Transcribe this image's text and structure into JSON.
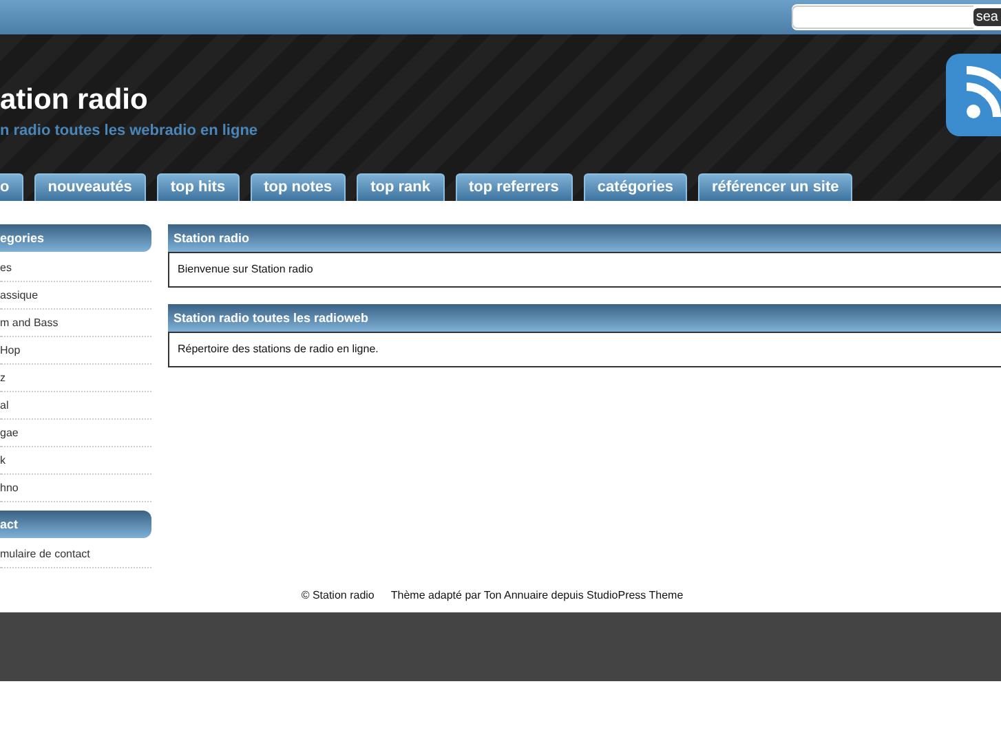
{
  "search": {
    "button": "sea"
  },
  "header": {
    "title": "ation radio",
    "tagline": "n radio toutes les webradio en ligne"
  },
  "nav": [
    {
      "label": "o",
      "selected": false
    },
    {
      "label": "nouveautés",
      "selected": false
    },
    {
      "label": "top hits",
      "selected": false
    },
    {
      "label": "top notes",
      "selected": false
    },
    {
      "label": "top rank",
      "selected": false
    },
    {
      "label": "top referrers",
      "selected": false
    },
    {
      "label": "catégories",
      "selected": false
    },
    {
      "label": "référencer un site",
      "selected": false
    }
  ],
  "sidebar": [
    {
      "title": "egories",
      "items": [
        "es",
        "assique",
        "m and Bass",
        "Hop",
        "z",
        "al",
        "gae",
        "k",
        "hno"
      ]
    },
    {
      "title": "act",
      "items": [
        "mulaire de contact"
      ]
    }
  ],
  "posts": [
    {
      "title": "Station radio",
      "body": "Bienvenue sur Station radio"
    },
    {
      "title": "Station radio toutes les radioweb",
      "body": "Répertoire des stations de radio en ligne."
    }
  ],
  "footer": {
    "copyright": "© Station radio",
    "credit": "Thème adapté par Ton Annuaire depuis StudioPress Theme"
  }
}
